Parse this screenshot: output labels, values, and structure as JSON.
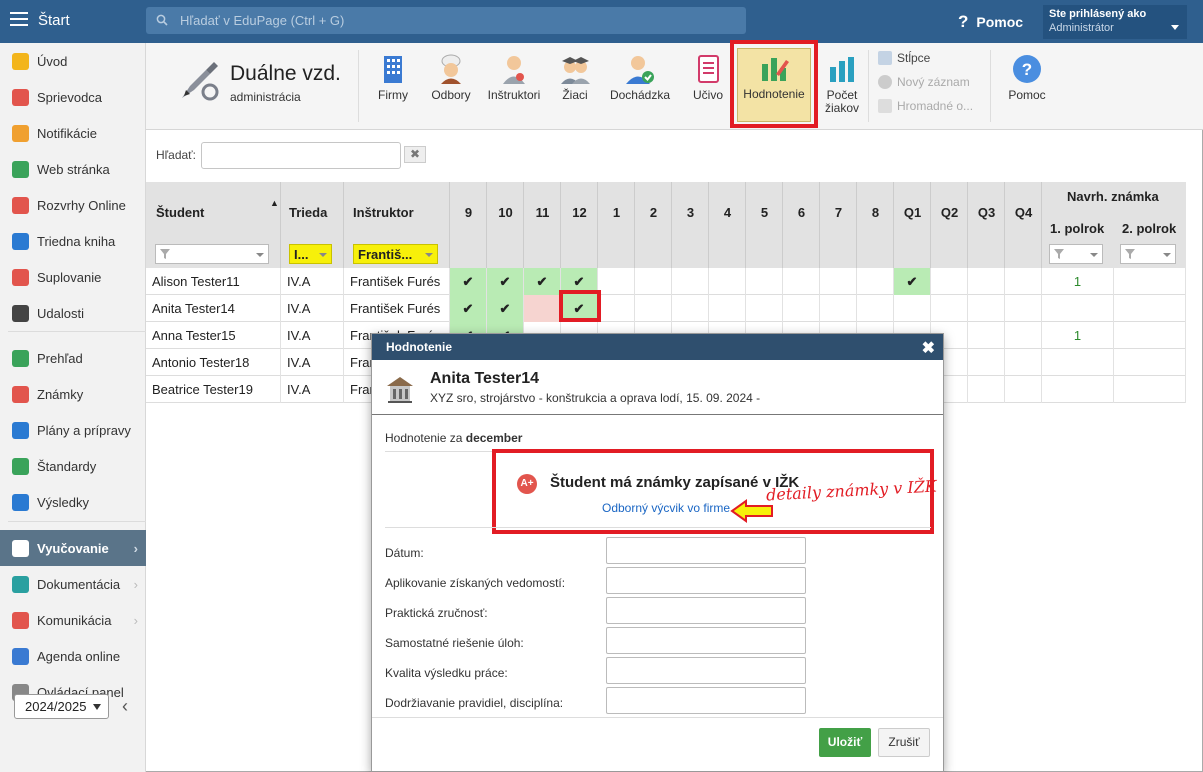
{
  "topbar": {
    "start": "Štart",
    "search_placeholder": "Hľadať v EduPage (Ctrl + G)",
    "help": "Pomoc",
    "user_line1": "Ste prihlásený ako",
    "user_line2": "Administrátor"
  },
  "sidebar": {
    "items": [
      {
        "label": "Úvod",
        "icon": "star-icon",
        "color": "#f3b51b"
      },
      {
        "label": "Sprievodca",
        "icon": "wand-icon",
        "color": "#e2554d"
      },
      {
        "label": "Notifikácie",
        "icon": "envelope-icon",
        "color": "#f0a030"
      },
      {
        "label": "Web stránka",
        "icon": "home-icon",
        "color": "#3aa35a"
      },
      {
        "label": "Rozvrhy Online",
        "icon": "grid-icon",
        "color": "#e2554d"
      },
      {
        "label": "Triedna kniha",
        "icon": "book-icon",
        "color": "#2a7ad2"
      },
      {
        "label": "Suplovanie",
        "icon": "person-icon",
        "color": "#e2554d"
      },
      {
        "label": "Udalosti",
        "icon": "calendar-icon",
        "color": "#444"
      },
      {
        "label": "Prehľad",
        "icon": "check-circle-icon",
        "color": "#3aa35a"
      },
      {
        "label": "Známky",
        "icon": "grade-icon",
        "color": "#e2554d"
      },
      {
        "label": "Plány a prípravy",
        "icon": "briefcase-icon",
        "color": "#2a7ad2"
      },
      {
        "label": "Štandardy",
        "icon": "shield-icon",
        "color": "#3aa35a"
      },
      {
        "label": "Výsledky",
        "icon": "bar-chart-icon",
        "color": "#2a7ad2"
      },
      {
        "label": "Vyučovanie",
        "icon": "open-book-icon",
        "color": "#ffffff"
      },
      {
        "label": "Dokumentácia",
        "icon": "document-icon",
        "color": "#2aa0a0"
      },
      {
        "label": "Komunikácia",
        "icon": "chat-icon",
        "color": "#e2554d"
      },
      {
        "label": "Agenda online",
        "icon": "pen-icon",
        "color": "#3a7ad2"
      },
      {
        "label": "Ovládací panel",
        "icon": "gear-icon",
        "color": "#888"
      }
    ],
    "year": "2024/2025"
  },
  "toolbar": {
    "title": "Duálne vzd.",
    "subtitle": "administrácia",
    "buttons": [
      "Firmy",
      "Odbory",
      "Inštruktori",
      "Žiaci",
      "Dochádzka",
      "Učivo",
      "Hodnotenie",
      "Počet žiakov",
      "Pomoc"
    ],
    "small": [
      "Stĺpce",
      "Nový záznam",
      "Hromadné o..."
    ]
  },
  "filter": {
    "label": "Hľadať:",
    "clear": "✖"
  },
  "table": {
    "headers": {
      "student": "Študent",
      "class": "Trieda",
      "instructor": "Inštruktor",
      "grade": "Navrh. známka",
      "sem1": "1. polrok",
      "sem2": "2. polrok"
    },
    "months": [
      "9",
      "10",
      "11",
      "12",
      "1",
      "2",
      "3",
      "4",
      "5",
      "6",
      "7",
      "8",
      "Q1",
      "Q2",
      "Q3",
      "Q4"
    ],
    "filters": {
      "class": "I...",
      "instructor": "Františ..."
    },
    "rows": [
      {
        "student": "Alison Tester11",
        "class": "IV.A",
        "instructor": "František Furés",
        "sem1": "1"
      },
      {
        "student": "Anita Tester14",
        "class": "IV.A",
        "instructor": "František Furés",
        "sem1": ""
      },
      {
        "student": "Anna Tester15",
        "class": "IV.A",
        "instructor": "František Furés",
        "sem1": "1"
      },
      {
        "student": "Antonio Tester18",
        "class": "IV.A",
        "instructor": "František Furés",
        "sem1": ""
      },
      {
        "student": "Beatrice Tester19",
        "class": "IV.A",
        "instructor": "František Furés",
        "sem1": ""
      }
    ]
  },
  "dialog": {
    "title": "Hodnotenie",
    "student": "Anita Tester14",
    "subtitle": "XYZ sro, strojárstvo - konštrukcia a oprava lodí, 15. 09. 2024 -",
    "hod_za": "Hodnotenie za",
    "month": "december",
    "izk_text": "Študent má známky zapísané v IŽK",
    "izk_badge": "A+",
    "izk_link": "Odborný výcvik vo firme",
    "annotation": "detaily známky v IŽK",
    "fields": [
      "Dátum:",
      "Aplikovanie získaných vedomostí:",
      "Praktická zručnosť:",
      "Samostatné riešenie úloh:",
      "Kvalita výsledku práce:",
      "Dodržiavanie pravidiel, disciplína:"
    ],
    "save": "Uložiť",
    "cancel": "Zrušiť"
  }
}
